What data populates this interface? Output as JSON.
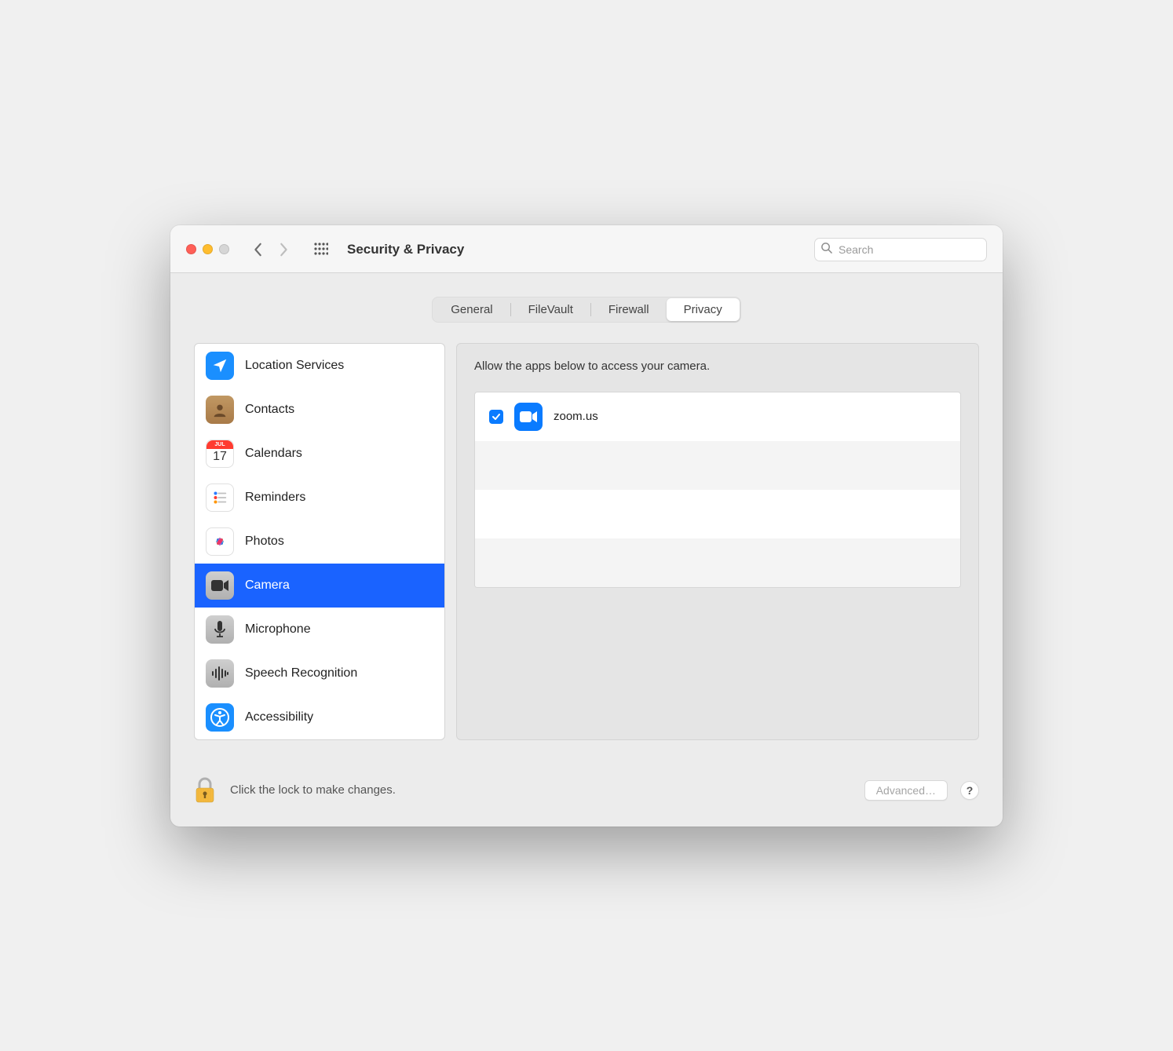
{
  "header": {
    "title": "Security & Privacy",
    "search_placeholder": "Search"
  },
  "tabs": {
    "items": [
      "General",
      "FileVault",
      "Firewall",
      "Privacy"
    ],
    "active_index": 3
  },
  "sidebar": {
    "items": [
      {
        "label": "Location Services",
        "icon": "location"
      },
      {
        "label": "Contacts",
        "icon": "contacts"
      },
      {
        "label": "Calendars",
        "icon": "calendar",
        "calendar_month": "JUL",
        "calendar_day": "17"
      },
      {
        "label": "Reminders",
        "icon": "reminders"
      },
      {
        "label": "Photos",
        "icon": "photos"
      },
      {
        "label": "Camera",
        "icon": "camera",
        "selected": true
      },
      {
        "label": "Microphone",
        "icon": "microphone"
      },
      {
        "label": "Speech Recognition",
        "icon": "speech"
      },
      {
        "label": "Accessibility",
        "icon": "accessibility"
      }
    ]
  },
  "content": {
    "header": "Allow the apps below to access your camera.",
    "apps": [
      {
        "name": "zoom.us",
        "checked": true,
        "icon": "zoom"
      }
    ]
  },
  "footer": {
    "lock_label": "Click the lock to make changes.",
    "advanced_label": "Advanced…",
    "help_label": "?"
  }
}
